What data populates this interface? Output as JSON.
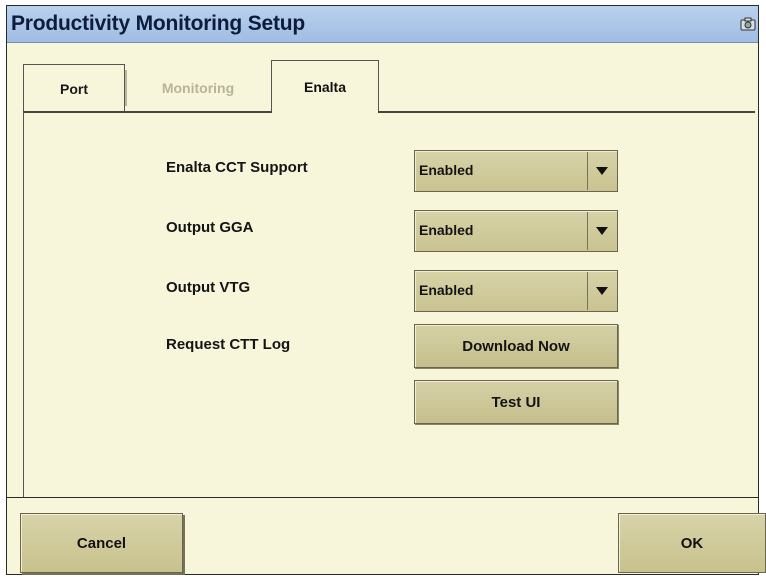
{
  "window": {
    "title": "Productivity Monitoring Setup",
    "icon": "camera-icon"
  },
  "tabs": [
    {
      "label": "Port",
      "state": "normal"
    },
    {
      "label": "Monitoring",
      "state": "disabled"
    },
    {
      "label": "Enalta",
      "state": "selected"
    }
  ],
  "settings": [
    {
      "label": "Enalta CCT Support",
      "value": "Enabled"
    },
    {
      "label": "Output GGA",
      "value": "Enabled"
    },
    {
      "label": "Output VTG",
      "value": "Enabled"
    }
  ],
  "request_log": {
    "label": "Request CTT Log",
    "button": "Download Now"
  },
  "test_button": "Test UI",
  "footer": {
    "cancel": "Cancel",
    "ok": "OK"
  },
  "colors": {
    "background": "#f7f5da",
    "titlebar": "#9fbde3",
    "button": "#cfca99",
    "disabled_text": "#b9b39a"
  }
}
